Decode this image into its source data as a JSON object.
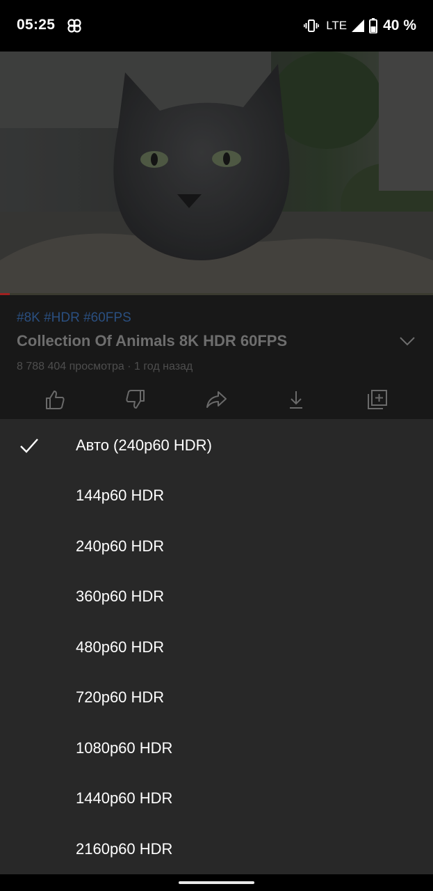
{
  "status_bar": {
    "time": "05:25",
    "app_icon": "pinwheel-icon",
    "network": "LTE",
    "battery": "40 %",
    "icons": [
      "vibrate-icon",
      "signal-icon",
      "battery-icon"
    ]
  },
  "video": {
    "thumbnail_description_icon": "video-player"
  },
  "info": {
    "hashtags": "#8K #HDR #60FPS",
    "title": "Collection Of Animals 8K HDR 60FPS",
    "meta": "8 788 404 просмотра · 1 год назад",
    "actions": [
      {
        "name": "like",
        "icon": "thumbs-up-icon"
      },
      {
        "name": "dislike",
        "icon": "thumbs-down-icon"
      },
      {
        "name": "share",
        "icon": "share-icon"
      },
      {
        "name": "download",
        "icon": "download-icon"
      },
      {
        "name": "save",
        "icon": "add-to-playlist-icon"
      }
    ]
  },
  "quality_menu": {
    "selected_index": 0,
    "items": [
      {
        "label": "Авто (240p60 HDR)"
      },
      {
        "label": "144p60 HDR"
      },
      {
        "label": "240p60 HDR"
      },
      {
        "label": "360p60 HDR"
      },
      {
        "label": "480p60 HDR"
      },
      {
        "label": "720p60 HDR"
      },
      {
        "label": "1080p60 HDR"
      },
      {
        "label": "1440p60 HDR"
      },
      {
        "label": "2160p60 HDR"
      }
    ]
  },
  "colors": {
    "sheet_bg": "#282828",
    "info_bg": "#181818",
    "hashtag": "#2a4f80",
    "text_primary": "#ffffff"
  }
}
